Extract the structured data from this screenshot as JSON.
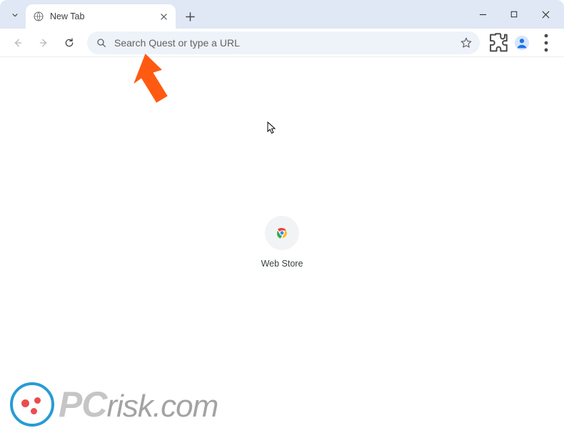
{
  "tab": {
    "title": "New Tab"
  },
  "omnibox": {
    "placeholder": "Search Quest or type a URL"
  },
  "shortcuts": [
    {
      "label": "Web Store"
    }
  ],
  "watermark": {
    "brand_pc": "PC",
    "brand_rest": "risk.com"
  }
}
